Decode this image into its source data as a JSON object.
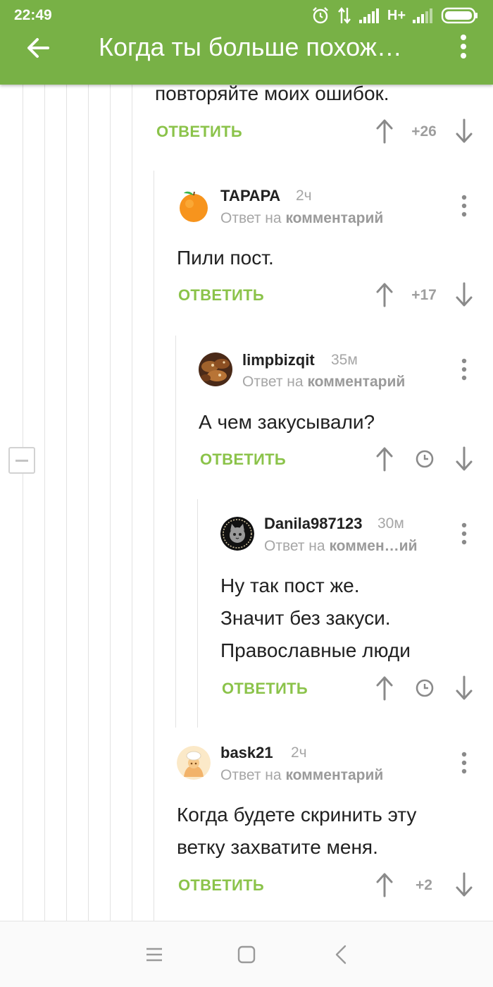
{
  "status_bar": {
    "time": "22:49",
    "network": "H+",
    "icons": [
      "alarm-icon",
      "data-transfer-icon",
      "signal-icon",
      "signal-icon",
      "battery-icon"
    ]
  },
  "app_bar": {
    "title": "Когда ты больше похож…",
    "icons": [
      "back-arrow-icon",
      "overflow-menu-icon"
    ]
  },
  "accent_color": "#78b146",
  "reply_color": "#8bc34a",
  "comments": [
    {
      "lines": [
        "повторяйте моих ошибок."
      ],
      "reply_label": "ОТВЕТИТЬ",
      "rating": "+26"
    },
    {
      "username": "ТАРАРА",
      "time": "2ч",
      "reply_to_prefix": "Ответ на",
      "reply_to_link": "комментарий",
      "avatar": "orange-avatar",
      "lines": [
        "Пили пост."
      ],
      "reply_label": "ОТВЕТИТЬ",
      "rating": "+17"
    },
    {
      "username": "limpbizqit",
      "time": "35м",
      "reply_to_prefix": "Ответ на",
      "reply_to_link": "комментарий",
      "avatar": "food-photo-avatar",
      "lines": [
        "А чем закусывали?"
      ],
      "reply_label": "ОТВЕТИТЬ",
      "rating_icon": "clock-icon"
    },
    {
      "username": "Danila987123",
      "time": "30м",
      "reply_to_prefix": "Ответ на",
      "reply_to_link": "коммен…ий",
      "avatar": "cat-badge-avatar",
      "lines": [
        "Ну так пост же.",
        "Значит без закуси.",
        "Православные люди"
      ],
      "reply_label": "ОТВЕТИТЬ",
      "rating_icon": "clock-icon"
    },
    {
      "username": "bask21",
      "time": "2ч",
      "reply_to_prefix": "Ответ на",
      "reply_to_link": "комментарий",
      "avatar": "chef-avatar",
      "lines": [
        "Когда будете скринить эту",
        "ветку захватите меня."
      ],
      "reply_label": "ОТВЕТИТЬ",
      "rating": "+2"
    }
  ],
  "nav_bar": {
    "icons": [
      "recent-apps-icon",
      "home-icon",
      "back-icon"
    ]
  }
}
